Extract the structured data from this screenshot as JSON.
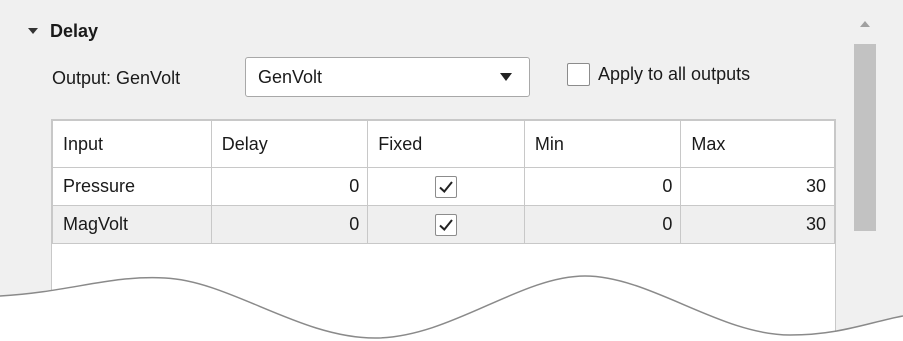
{
  "section": {
    "title": "Delay",
    "expanded": true,
    "arrow_icon": "triangle-down-icon"
  },
  "output": {
    "label": "Output: GenVolt",
    "dropdown_value": "GenVolt",
    "apply_all_label": "Apply to all outputs",
    "apply_all_checked": false
  },
  "table": {
    "headers": [
      "Input",
      "Delay",
      "Fixed",
      "Min",
      "Max"
    ],
    "rows": [
      {
        "input": "Pressure",
        "delay": "0",
        "fixed": true,
        "min": "0",
        "max": "30"
      },
      {
        "input": "MagVolt",
        "delay": "0",
        "fixed": true,
        "min": "0",
        "max": "30"
      }
    ]
  },
  "colors": {
    "panel_bg": "#f0f0f0",
    "alt_row": "#efefef",
    "border": "#c8c8c8",
    "scroll_thumb": "#c2c2c2"
  }
}
